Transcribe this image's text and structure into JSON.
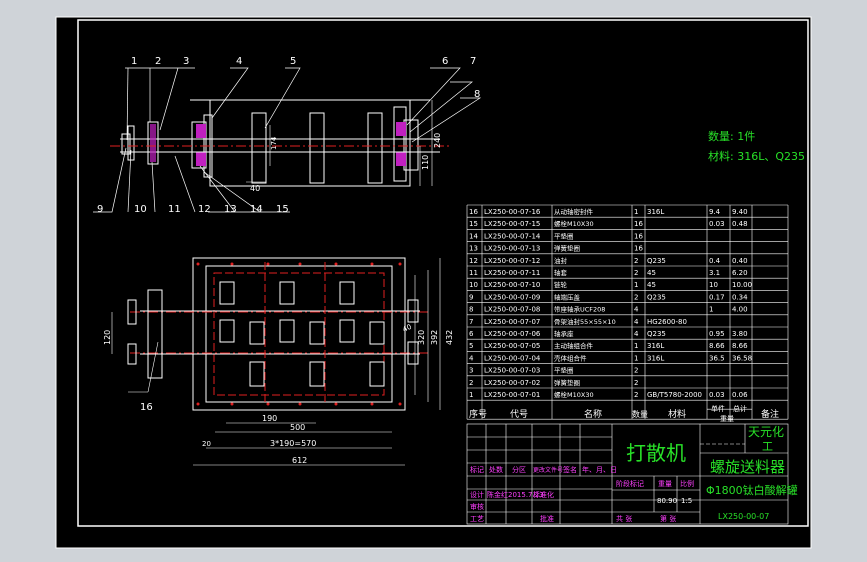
{
  "drawing": {
    "qty_note": "数量: 1件",
    "material_note": "材料: 316L、Q235",
    "dims_top": {
      "d240": "240",
      "d110": "110",
      "d40": "40",
      "d174": "174"
    },
    "dims_bottom": {
      "d190": "190",
      "d500": "500",
      "d3x190": "3*190=570",
      "d612": "612",
      "d120": "120",
      "d320": "320",
      "d392": "392",
      "d432": "432",
      "d20": "20",
      "d40": "40"
    },
    "leaders_top": [
      "1",
      "2",
      "3",
      "4",
      "5",
      "6",
      "7",
      "8",
      "9",
      "10",
      "11",
      "12",
      "13",
      "14",
      "15"
    ],
    "leader_16": "16"
  },
  "bom": {
    "rows": [
      {
        "no": "16",
        "code": "LX250-00-07-16",
        "name": "从动轴密封件",
        "qty": "1",
        "mat": "316L",
        "w1": "9.4",
        "w2": "9.40"
      },
      {
        "no": "15",
        "code": "LX250-00-07-15",
        "name": "螺栓M10X30",
        "qty": "16",
        "mat": "",
        "w1": "0.03",
        "w2": "0.48"
      },
      {
        "no": "14",
        "code": "LX250-00-07-14",
        "name": "平垫圈",
        "qty": "16",
        "mat": "",
        "w1": "",
        "w2": ""
      },
      {
        "no": "13",
        "code": "LX250-00-07-13",
        "name": "弹簧垫圈",
        "qty": "16",
        "mat": "",
        "w1": "",
        "w2": ""
      },
      {
        "no": "12",
        "code": "LX250-00-07-12",
        "name": "油封",
        "qty": "2",
        "mat": "Q235",
        "w1": "0.4",
        "w2": "0.40"
      },
      {
        "no": "11",
        "code": "LX250-00-07-11",
        "name": "轴套",
        "qty": "2",
        "mat": "45",
        "w1": "3.1",
        "w2": "6.20"
      },
      {
        "no": "10",
        "code": "LX250-00-07-10",
        "name": "链轮",
        "qty": "1",
        "mat": "45",
        "w1": "10",
        "w2": "10.00"
      },
      {
        "no": "9",
        "code": "LX250-00-07-09",
        "name": "轴端压盖",
        "qty": "2",
        "mat": "Q235",
        "w1": "0.17",
        "w2": "0.34"
      },
      {
        "no": "8",
        "code": "LX250-00-07-08",
        "name": "带座轴承UCF208",
        "qty": "4",
        "mat": "",
        "w1": "1",
        "w2": "4.00"
      },
      {
        "no": "7",
        "code": "LX250-00-07-07",
        "name": "骨架油封55×55×10",
        "qty": "4",
        "mat": "HG2600-80",
        "w1": "",
        "w2": ""
      },
      {
        "no": "6",
        "code": "LX250-00-07-06",
        "name": "轴承座",
        "qty": "4",
        "mat": "Q235",
        "w1": "0.95",
        "w2": "3.80"
      },
      {
        "no": "5",
        "code": "LX250-00-07-05",
        "name": "主动轴组合件",
        "qty": "1",
        "mat": "316L",
        "w1": "8.66",
        "w2": "8.66"
      },
      {
        "no": "4",
        "code": "LX250-00-07-04",
        "name": "壳体组合件",
        "qty": "1",
        "mat": "316L",
        "w1": "36.5",
        "w2": "36.58"
      },
      {
        "no": "3",
        "code": "LX250-00-07-03",
        "name": "平垫圈",
        "qty": "2",
        "mat": "",
        "w1": "",
        "w2": ""
      },
      {
        "no": "2",
        "code": "LX250-00-07-02",
        "name": "弹簧垫圈",
        "qty": "2",
        "mat": "",
        "w1": "",
        "w2": ""
      },
      {
        "no": "1",
        "code": "LX250-00-07-01",
        "name": "螺栓M10X30",
        "qty": "2",
        "mat": "GB/T5780-2000",
        "w1": "0.03",
        "w2": "0.06"
      }
    ],
    "header": {
      "no": "序号",
      "code": "代号",
      "name": "名称",
      "qty": "数量",
      "mat": "材料",
      "w_single": "单件",
      "w_total": "总计",
      "weight": "重量",
      "remark": "备注"
    }
  },
  "title_block": {
    "product": "打散机",
    "company_line1": "天元化",
    "company_line2": "工",
    "part_name": "螺旋送料器",
    "assembly_name": "Φ1800钛白酸解罐",
    "drawing_no": "LX250-00-07",
    "labels": {
      "mark": "标记",
      "count": "处数",
      "zone": "分区",
      "change_doc": "更改文件号",
      "sign": "签名",
      "date": "年、月、日",
      "design": "设计",
      "standard": "标准化",
      "review": "审核",
      "craft": "工艺",
      "approve": "批准",
      "stage": "阶段标记",
      "weight": "重量",
      "scale": "比例",
      "sheets": "共  张",
      "sheet": "第  张"
    },
    "designer": "陈金红",
    "design_date": "2015.7.23",
    "weight_val": "80.90",
    "scale_val": "1:5"
  }
}
